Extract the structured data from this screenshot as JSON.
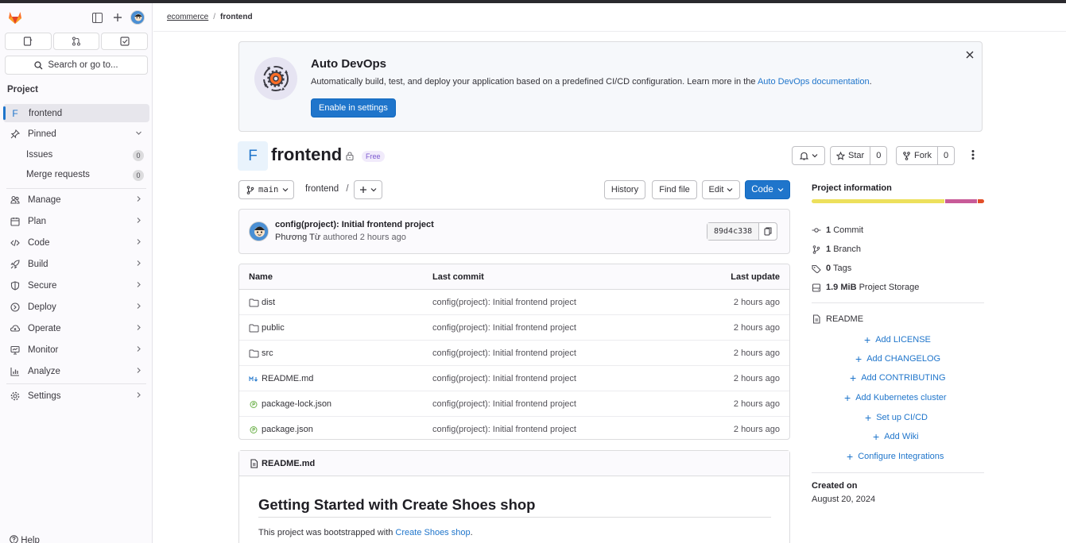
{
  "sidebar": {
    "search_label": "Search or go to...",
    "section_title": "Project",
    "project": {
      "letter": "F",
      "name": "frontend"
    },
    "pinned_label": "Pinned",
    "pinned_items": [
      {
        "label": "Issues",
        "count": "0"
      },
      {
        "label": "Merge requests",
        "count": "0"
      }
    ],
    "nav": [
      {
        "label": "Manage",
        "icon": "users-icon"
      },
      {
        "label": "Plan",
        "icon": "calendar-icon"
      },
      {
        "label": "Code",
        "icon": "code-icon"
      },
      {
        "label": "Build",
        "icon": "rocket-icon"
      },
      {
        "label": "Secure",
        "icon": "shield-icon"
      },
      {
        "label": "Deploy",
        "icon": "deploy-icon"
      },
      {
        "label": "Operate",
        "icon": "cloud-gear-icon"
      },
      {
        "label": "Monitor",
        "icon": "monitor-icon"
      },
      {
        "label": "Analyze",
        "icon": "chart-icon"
      }
    ],
    "settings_label": "Settings",
    "help_label": "Help"
  },
  "breadcrumb": {
    "group": "ecommerce",
    "project": "frontend"
  },
  "banner": {
    "title": "Auto DevOps",
    "text": "Automatically build, test, and deploy your application based on a predefined CI/CD configuration. Learn more in the ",
    "link": "Auto DevOps documentation",
    "text_end": ".",
    "button": "Enable in settings"
  },
  "project": {
    "letter": "F",
    "name": "frontend",
    "badge": "Free",
    "star_label": "Star",
    "star_count": "0",
    "fork_label": "Fork",
    "fork_count": "0"
  },
  "toolbar": {
    "branch": "main",
    "path": "frontend",
    "path_sep": "/",
    "history": "History",
    "find_file": "Find file",
    "edit": "Edit",
    "code": "Code"
  },
  "commit": {
    "title": "config(project): Initial frontend project",
    "author": "Phương Từ",
    "meta": "authored 2 hours ago",
    "sha": "89d4c338"
  },
  "files": {
    "headers": {
      "name": "Name",
      "commit": "Last commit",
      "date": "Last update"
    },
    "rows": [
      {
        "name": "dist",
        "type": "folder",
        "commit": "config(project): Initial frontend project",
        "date": "2 hours ago"
      },
      {
        "name": "public",
        "type": "folder",
        "commit": "config(project): Initial frontend project",
        "date": "2 hours ago"
      },
      {
        "name": "src",
        "type": "folder",
        "commit": "config(project): Initial frontend project",
        "date": "2 hours ago"
      },
      {
        "name": "README.md",
        "type": "markdown",
        "commit": "config(project): Initial frontend project",
        "date": "2 hours ago"
      },
      {
        "name": "package-lock.json",
        "type": "npm",
        "commit": "config(project): Initial frontend project",
        "date": "2 hours ago"
      },
      {
        "name": "package.json",
        "type": "npm",
        "commit": "config(project): Initial frontend project",
        "date": "2 hours ago"
      }
    ]
  },
  "readme": {
    "filename": "README.md",
    "heading": "Getting Started with Create Shoes shop",
    "text": "This project was bootstrapped with ",
    "link": "Create Shoes shop",
    "text_end": "."
  },
  "info": {
    "title": "Project information",
    "commits": {
      "value": "1",
      "label": "Commit"
    },
    "branches": {
      "value": "1",
      "label": "Branch"
    },
    "tags": {
      "value": "0",
      "label": "Tags"
    },
    "storage": {
      "value": "1.9 MiB",
      "label": "Project Storage"
    },
    "readme": "README",
    "links": [
      "Add LICENSE",
      "Add CHANGELOG",
      "Add CONTRIBUTING",
      "Add Kubernetes cluster",
      "Set up CI/CD",
      "Add Wiki",
      "Configure Integrations"
    ],
    "created_label": "Created on",
    "created_date": "August 20, 2024",
    "languages": [
      {
        "share": 0.775,
        "color": "#ede05c"
      },
      {
        "share": 0.19,
        "color": "#c85b98"
      },
      {
        "share": 0.035,
        "color": "#e24e28"
      }
    ]
  }
}
